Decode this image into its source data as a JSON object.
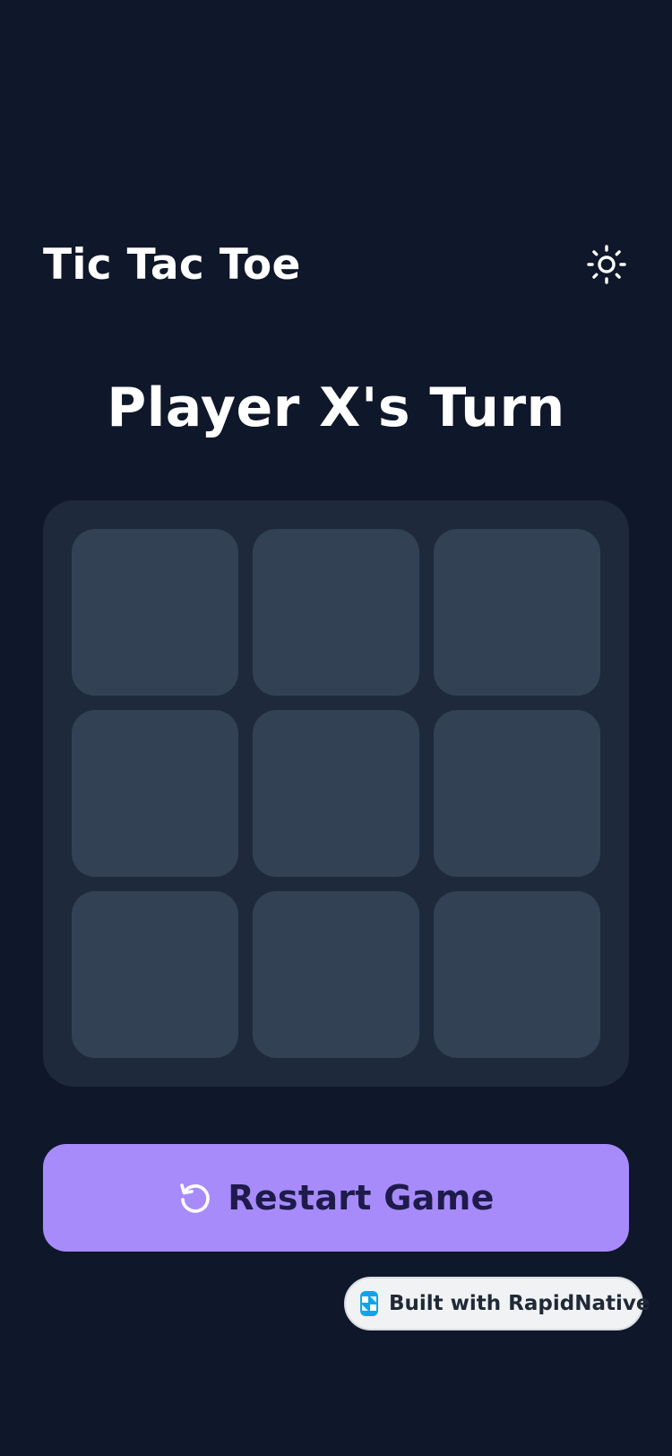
{
  "header": {
    "title": "Tic Tac Toe",
    "theme_toggle_icon": "sun-icon"
  },
  "status": {
    "turn_text": "Player X's Turn"
  },
  "board": {
    "cells": [
      "",
      "",
      "",
      "",
      "",
      "",
      "",
      "",
      ""
    ]
  },
  "restart": {
    "label": "Restart Game",
    "icon": "restart-icon"
  },
  "badge": {
    "label": "Built with RapidNative",
    "icon": "rapidnative-logo-icon"
  },
  "colors": {
    "background": "#0f172a",
    "board": "#1e293b",
    "cell": "#334155",
    "accent": "#a78bfa",
    "accent_text": "#1e1b4b",
    "badge_bg": "#f1f2f4",
    "badge_logo": "#0ea5e9"
  }
}
